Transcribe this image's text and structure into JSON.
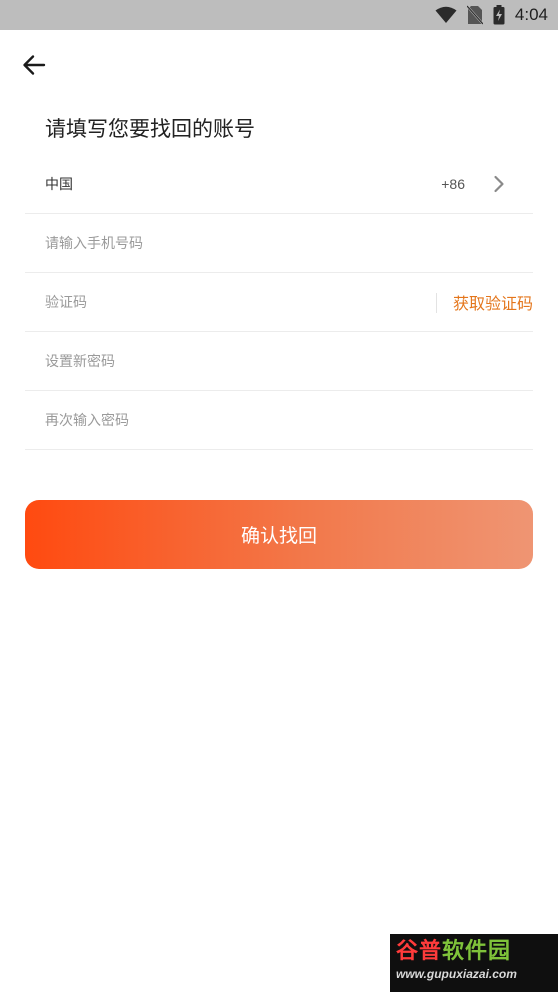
{
  "status_bar": {
    "time": "4:04",
    "icons": [
      "wifi-icon",
      "no-sim-icon",
      "battery-charging-icon"
    ]
  },
  "header": {
    "back_icon": "arrow-left-icon"
  },
  "page": {
    "title": "请填写您要找回的账号"
  },
  "form": {
    "country": {
      "label": "中国",
      "code": "+86",
      "chevron_icon": "chevron-right-icon"
    },
    "phone": {
      "placeholder": "请输入手机号码"
    },
    "verification": {
      "placeholder": "验证码",
      "get_code_label": "获取验证码"
    },
    "new_password": {
      "placeholder": "设置新密码"
    },
    "confirm_password": {
      "placeholder": "再次输入密码"
    }
  },
  "actions": {
    "confirm_label": "确认找回"
  },
  "watermark": {
    "title_part1": "谷普",
    "title_part2": "软件园",
    "url": "www.gupuxiazai.com"
  },
  "colors": {
    "accent_orange": "#e4761c",
    "button_gradient_start": "#ff4a10",
    "button_gradient_end": "#ef9573",
    "status_bar": "#bdbdbd"
  }
}
